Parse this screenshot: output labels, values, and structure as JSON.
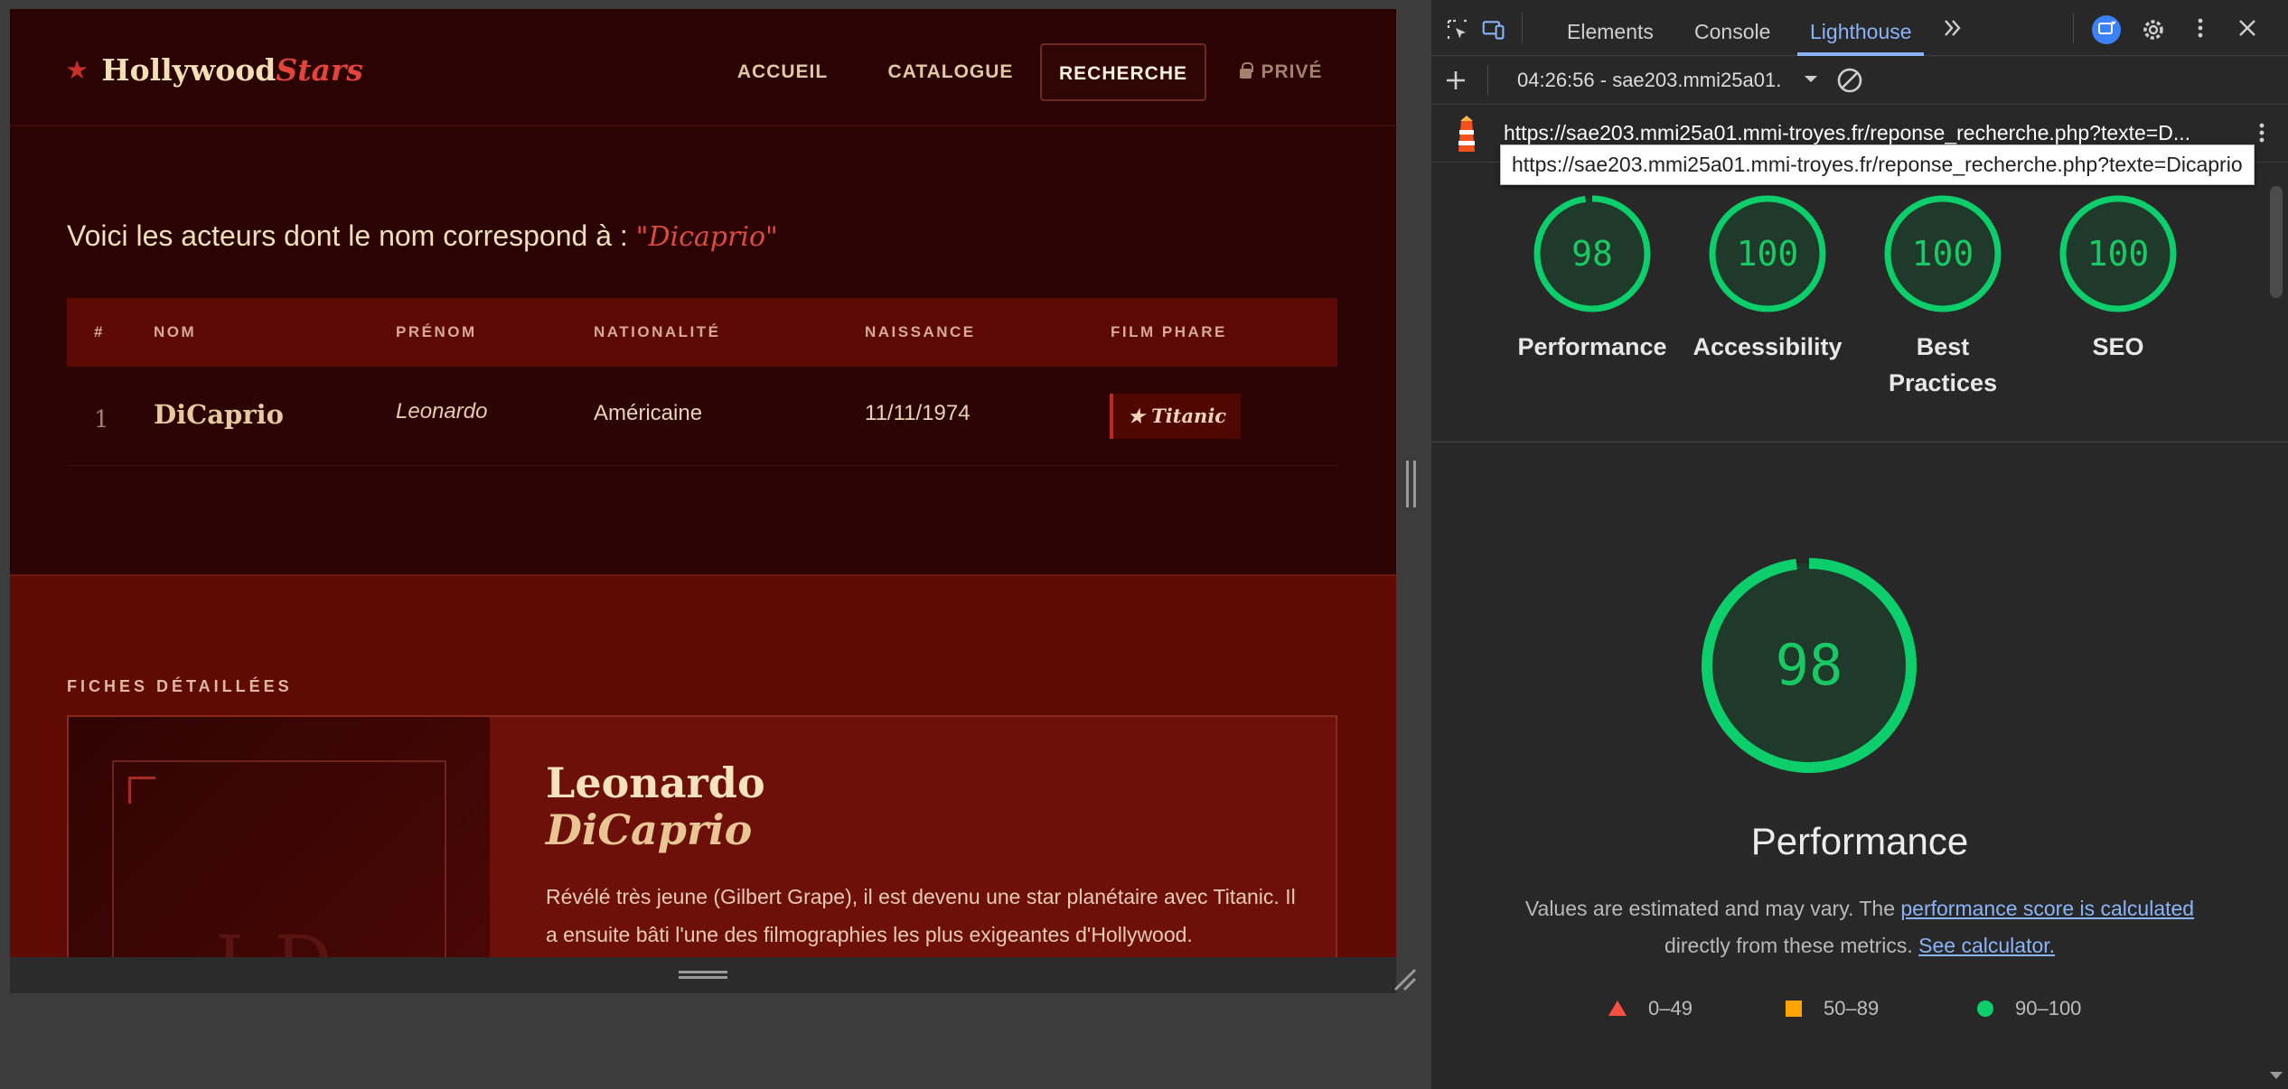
{
  "site": {
    "logo_main": "Hollywood",
    "logo_accent": "Stars",
    "nav": [
      {
        "label": "ACCUEIL"
      },
      {
        "label": "CATALOGUE"
      },
      {
        "label": "RECHERCHE"
      },
      {
        "label": "PRIVÉ"
      }
    ],
    "intro_text": "Voici les acteurs dont le nom correspond à :",
    "query": "\"Dicaprio\"",
    "table": {
      "headers": [
        "#",
        "NOM",
        "PRÉNOM",
        "NATIONALITÉ",
        "NAISSANCE",
        "FILM PHARE"
      ],
      "rows": [
        {
          "num": "1",
          "nom": "DiCaprio",
          "prenom": "Leonardo",
          "nationalite": "Américaine",
          "naissance": "11/11/1974",
          "film": "★ Titanic"
        }
      ]
    },
    "fiches": {
      "section_title": "FICHES DÉTAILLÉES",
      "card": {
        "initials": "LD",
        "firstname": "Leonardo",
        "lastname": "DiCaprio",
        "bio": "Révélé très jeune (Gilbert Grape), il est devenu une star planétaire avec Titanic. Il a ensuite bâti l'une des filmographies les plus exigeantes d'Hollywood."
      }
    }
  },
  "devtools": {
    "tabs": [
      "Elements",
      "Console",
      "Lighthouse"
    ],
    "active_tab": "Lighthouse",
    "report_label": "04:26:56 - sae203.mmi25a01.",
    "url": "https://sae203.mmi25a01.mmi-troyes.fr/reponse_recherche.php?texte=D...",
    "tooltip": "https://sae203.mmi25a01.mmi-troyes.fr/reponse_recherche.php?texte=Dicaprio",
    "scores": [
      {
        "label": "Performance",
        "score": 98
      },
      {
        "label": "Accessibility",
        "score": 100
      },
      {
        "label": "Best Practices",
        "score": 100
      },
      {
        "label": "SEO",
        "score": 100
      }
    ],
    "main_score": {
      "label": "Performance",
      "score": 98
    },
    "note": {
      "prefix": "Values are estimated and may vary. The",
      "link1": "performance score is calculated",
      "middle": "directly from these metrics.",
      "link2": "See calculator."
    },
    "legend": [
      {
        "label": "0–49",
        "color": "#ff4e42"
      },
      {
        "label": "50–89",
        "color": "#ffa400"
      },
      {
        "label": "90–100",
        "color": "#0cce6b"
      }
    ],
    "score_color": "#0cce6b"
  }
}
